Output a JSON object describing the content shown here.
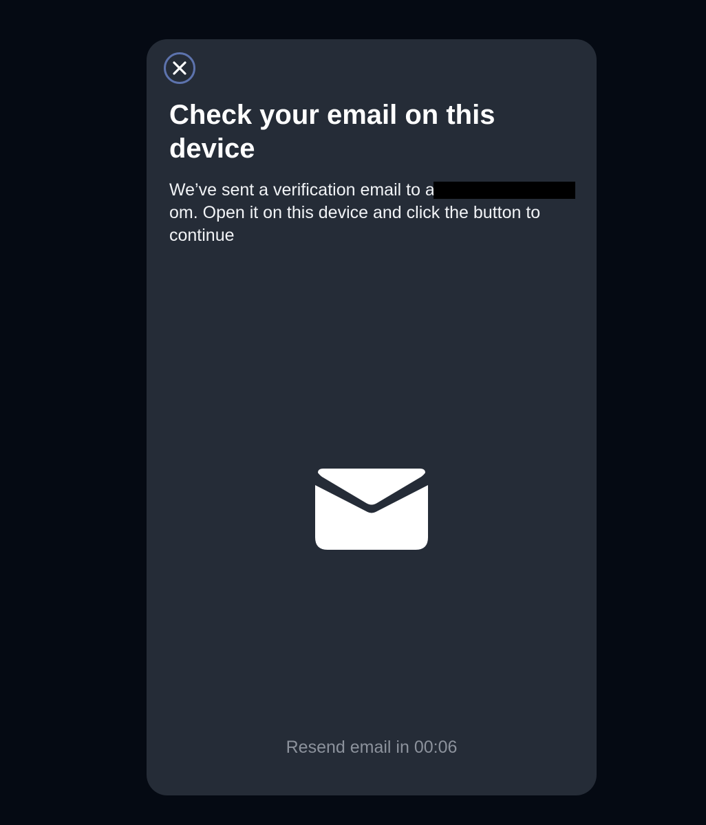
{
  "dialog": {
    "close_icon": "close-icon",
    "title": "Check your email on this device",
    "description": {
      "prefix": "We’ve sent a verification email to a",
      "suffix": "om. Open it on this device and click the button to continue"
    },
    "illustration_icon": "mail-envelope-icon",
    "resend": "Resend email in 00:06"
  },
  "colors": {
    "page_background": "#050a13",
    "dialog_background": "#252c37",
    "close_ring": "#5d73ad",
    "text_primary": "#ffffff",
    "text_muted": "#8c929c"
  }
}
